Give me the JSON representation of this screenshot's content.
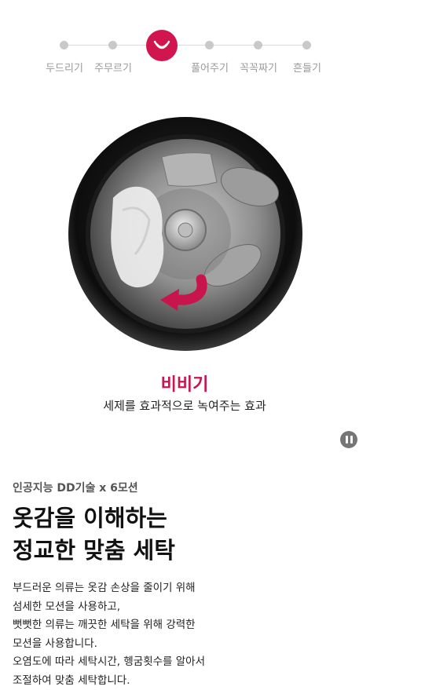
{
  "progress": {
    "steps_left": [
      "두드리기",
      "주무르기"
    ],
    "steps_right": [
      "풀어주기",
      "꼭꼭짜기",
      "흔들기"
    ],
    "active_icon": "smile-drum-icon",
    "accent": "#d1154f"
  },
  "motion": {
    "title": "비비기",
    "subtitle": "세제를 효과적으로 녹여주는 효과"
  },
  "controls": {
    "pause_icon": "pause-icon"
  },
  "feature": {
    "eyebrow": "인공지능 DD기술 x 6모션",
    "headline": [
      "옷감을 이해하는",
      "정교한 맞춤 세탁"
    ],
    "body": [
      "부드러운 의류는 옷감 손상을 줄이기 위해",
      "섬세한 모션을 사용하고,",
      "뻣뻣한 의류는 깨끗한 세탁을 위해 강력한",
      "모션을 사용합니다.",
      "오염도에 따라 세탁시간, 헹굼횟수를 알아서",
      "조절하여 맞춤 세탁합니다."
    ]
  }
}
